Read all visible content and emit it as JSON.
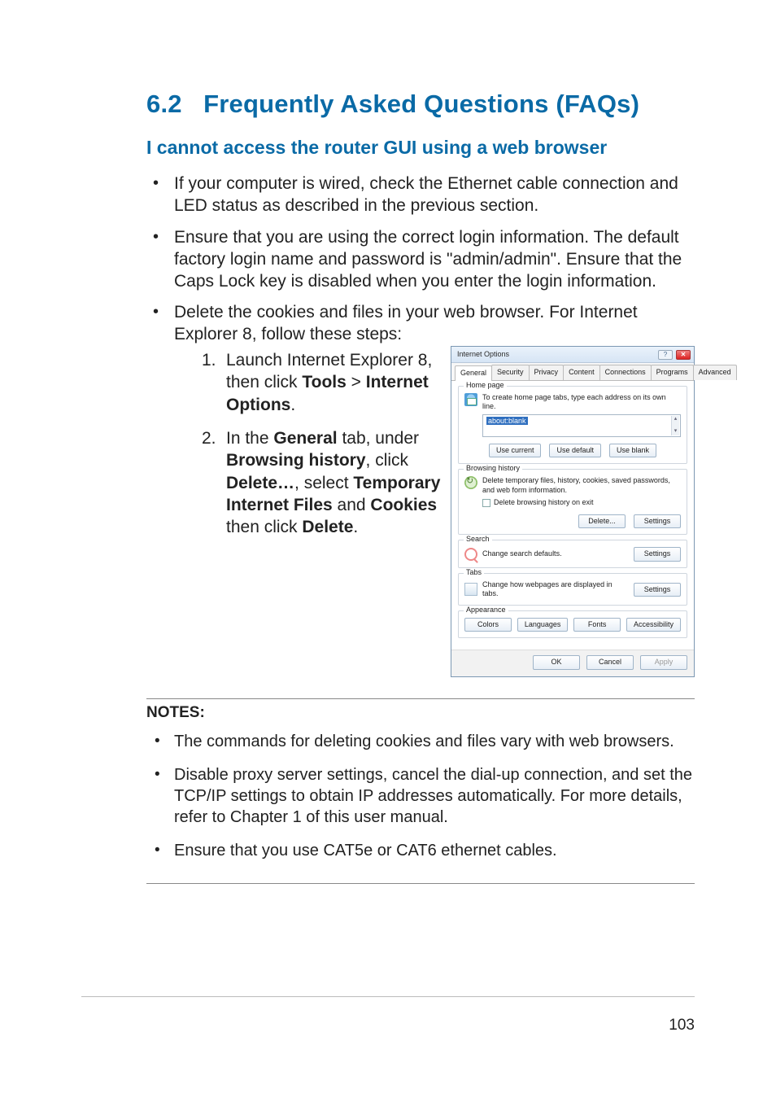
{
  "page_number": "103",
  "section": {
    "number": "6.2",
    "title": "Frequently Asked Questions (FAQs)"
  },
  "subhead": "I cannot access the router GUI using a web browser",
  "bullets": [
    "If your computer is wired, check the Ethernet cable connection and LED status as described in the previous section.",
    "Ensure that you are using the correct login information. The default factory login name and password is \"admin/admin\". Ensure that the Caps Lock key is disabled when you enter the login information.",
    "Delete the cookies and files in your web browser. For Internet Explorer 8, follow these steps:"
  ],
  "steps": {
    "s1": {
      "num": "1.",
      "pre": "Launch Internet Explorer 8, then click ",
      "b1": "Tools",
      "mid": " > ",
      "b2": "Internet Options",
      "post": "."
    },
    "s2": {
      "num": "2.",
      "pre": "In the ",
      "b1": "General",
      "mid1": " tab, under ",
      "b2": "Browsing history",
      "mid2": ", click ",
      "b3": "Delete…",
      "mid3": ", select ",
      "b4": "Temporary Internet Files",
      "mid4": " and ",
      "b5": "Cookies",
      "mid5": " then click ",
      "b6": "Delete",
      "post": "."
    }
  },
  "notes_label": "NOTES:",
  "notes": [
    "The commands for deleting cookies and files vary with web browsers.",
    "Disable proxy server settings, cancel the dial-up connection, and set the TCP/IP settings to obtain IP addresses automatically. For more details, refer to Chapter 1 of this user manual.",
    "Ensure that you use CAT5e or CAT6 ethernet cables."
  ],
  "dialog": {
    "title": "Internet Options",
    "tabs": [
      "General",
      "Security",
      "Privacy",
      "Content",
      "Connections",
      "Programs",
      "Advanced"
    ],
    "homepage": {
      "legend": "Home page",
      "desc": "To create home page tabs, type each address on its own line.",
      "value": "about:blank",
      "buttons": [
        "Use current",
        "Use default",
        "Use blank"
      ]
    },
    "history": {
      "legend": "Browsing history",
      "desc": "Delete temporary files, history, cookies, saved passwords, and web form information.",
      "checkbox": "Delete browsing history on exit",
      "buttons": [
        "Delete...",
        "Settings"
      ]
    },
    "search": {
      "legend": "Search",
      "desc": "Change search defaults.",
      "button": "Settings"
    },
    "tabs_section": {
      "legend": "Tabs",
      "desc": "Change how webpages are displayed in tabs.",
      "button": "Settings"
    },
    "appearance": {
      "legend": "Appearance",
      "buttons": [
        "Colors",
        "Languages",
        "Fonts",
        "Accessibility"
      ]
    },
    "footer": [
      "OK",
      "Cancel",
      "Apply"
    ]
  }
}
